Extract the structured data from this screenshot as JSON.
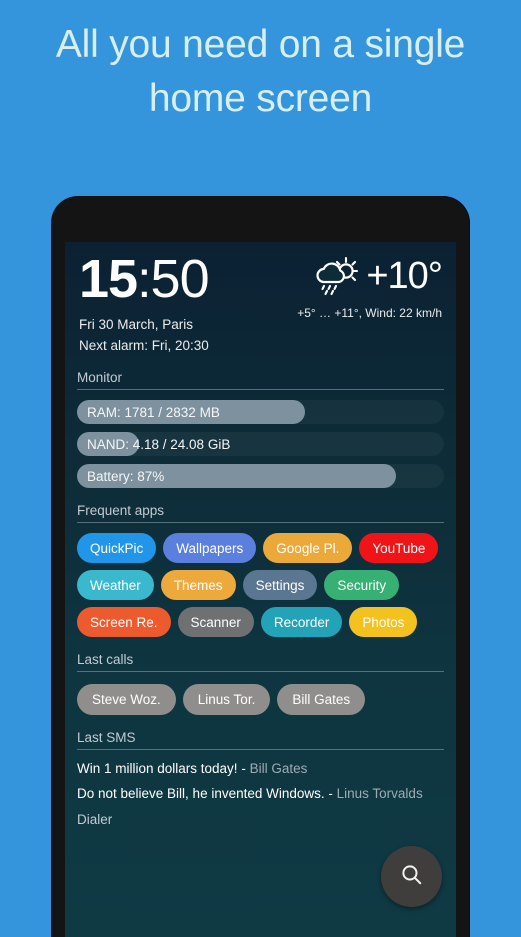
{
  "headline": {
    "line1": "All you need on a single",
    "line2": "home screen"
  },
  "colors": {
    "page_background": "#3494dc",
    "headline_text": "#d8efef",
    "screen_top": "#0b2133",
    "screen_bottom": "#0f3a44",
    "bar_fill": "#7d929e",
    "contact_chip": "#8f8e8c",
    "fab": "#3f3e3c"
  },
  "clock": {
    "hours": "15",
    "separator": ":",
    "minutes": "50",
    "date_location": "Fri 30 March, Paris",
    "alarm": "Next alarm: Fri, 20:30"
  },
  "weather": {
    "icon": "sun-behind-rain-cloud-icon",
    "temperature": "+10°",
    "details": "+5° … +11°, Wind: 22 km/h"
  },
  "monitor": {
    "title": "Monitor",
    "bars": [
      {
        "label": "RAM: 1781 / 2832 MB",
        "percent": 62
      },
      {
        "label": "NAND: 4.18 / 24.08 GiB",
        "percent": 17
      },
      {
        "label": "Battery: 87%",
        "percent": 87
      }
    ]
  },
  "frequent_apps": {
    "title": "Frequent apps",
    "items": [
      {
        "label": "QuickPic",
        "color": "#2196e8"
      },
      {
        "label": "Wallpapers",
        "color": "#5b7fdd"
      },
      {
        "label": "Google Pl.",
        "color": "#eba93a"
      },
      {
        "label": "YouTube",
        "color": "#ef1418"
      },
      {
        "label": "Weather",
        "color": "#3ab8ce"
      },
      {
        "label": "Themes",
        "color": "#eda93c"
      },
      {
        "label": "Settings",
        "color": "#5a7690"
      },
      {
        "label": "Security",
        "color": "#37b073"
      },
      {
        "label": "Screen Re.",
        "color": "#ed5a2d"
      },
      {
        "label": "Scanner",
        "color": "#6f7072"
      },
      {
        "label": "Recorder",
        "color": "#23a3b8"
      },
      {
        "label": "Photos",
        "color": "#f3c21f"
      }
    ]
  },
  "last_calls": {
    "title": "Last calls",
    "items": [
      {
        "label": "Steve Woz."
      },
      {
        "label": "Linus Tor."
      },
      {
        "label": "Bill Gates"
      }
    ]
  },
  "last_sms": {
    "title": "Last SMS",
    "items": [
      {
        "text": "Win 1 million dollars today! - ",
        "sender": "Bill Gates"
      },
      {
        "text": "Do not believe Bill, he invented Windows. - ",
        "sender": "Linus Torvalds"
      }
    ]
  },
  "next_section": {
    "title": "Dialer"
  },
  "fab": {
    "icon": "search-icon",
    "label": "Search"
  }
}
